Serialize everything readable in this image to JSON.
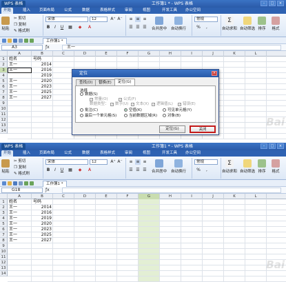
{
  "app": {
    "name": "WPS 表格",
    "window_title": "工作簿1 * - WPS 表格",
    "controls": [
      "–",
      "□",
      "×"
    ]
  },
  "menu": [
    "开始",
    "插入",
    "页面布局",
    "公式",
    "数据",
    "表格样式",
    "审阅",
    "视图",
    "开发工具",
    "办公空间"
  ],
  "ribbon": {
    "paste": "粘贴",
    "cut": "剪切",
    "copy": "复制",
    "format_painter": "格式刷",
    "font_name": "宋体",
    "font_size": "12",
    "bold": "B",
    "italic": "I",
    "underline": "U",
    "font_color": "A",
    "grow": "A⁺",
    "shrink": "A⁻",
    "merge_center": "合并居中",
    "wrap_text": "自动换行",
    "number_format": "常规",
    "currency": "%",
    "autosum": "自动求和",
    "autofilter": "自动筛选",
    "sort": "排序",
    "format": "格式"
  },
  "doc_tab": "工作簿1 *",
  "shot1": {
    "name_box": "A3",
    "formula": "王一",
    "watermark": "Bai"
  },
  "shot2": {
    "name_box": "G18",
    "formula": "",
    "watermark": "Bai"
  },
  "columns": [
    "A",
    "B",
    "C",
    "D",
    "E",
    "F",
    "G",
    "H",
    "I",
    "J",
    "K",
    "L"
  ],
  "rows": [
    "1",
    "2",
    "3",
    "4",
    "5",
    "6",
    "7",
    "8",
    "9",
    "10",
    "11",
    "12",
    "13",
    "14"
  ],
  "table": {
    "headers": [
      "姓名",
      "号码"
    ],
    "names1": [
      "王一",
      "王一",
      "",
      "王一",
      "王一",
      "王一",
      "王一"
    ],
    "names2": [
      "王一",
      "王一",
      "王一",
      "王一",
      "王一",
      "王一",
      "王一"
    ],
    "numbers": [
      "2014",
      "2016",
      "2019",
      "2020",
      "2023",
      "2025",
      "2027"
    ]
  },
  "dialog": {
    "title": "定位",
    "tabs": [
      "查找(D)",
      "替换(E)",
      "定位(G)"
    ],
    "group": "选择",
    "options": {
      "data": "数据(S)",
      "constant": "常量(O)",
      "formula": "公式(F)",
      "data_type": "数据类型：",
      "number": "数字(U)",
      "text": "文本(X)",
      "logical": "逻辑值(L)",
      "error": "错误(E)",
      "comment": "批注(C)",
      "blank": "空值(K)",
      "visible": "可见单元格(Y)",
      "last_cell": "最后一个单元格(S)",
      "current_region": "当前数据区域(R)",
      "objects": "对象(B)"
    },
    "locate_button": "定位(G)",
    "close_button": "关闭"
  }
}
